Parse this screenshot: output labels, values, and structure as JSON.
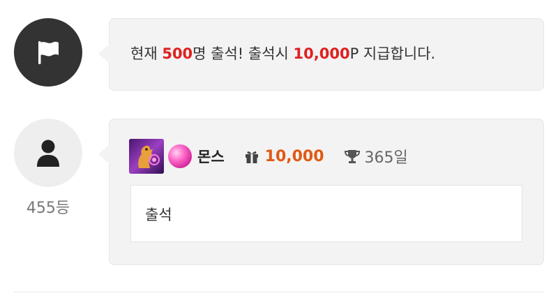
{
  "notice": {
    "prefix": "현재 ",
    "count": "500",
    "middle": "명 출석! 출석시 ",
    "reward": "10,000",
    "suffix": "P 지급합니다."
  },
  "post": {
    "rank": "455등",
    "nickname": "몬스",
    "points": "10,000",
    "days": "365일",
    "content": "출석"
  },
  "icons": {
    "notice_avatar": "flag-icon",
    "user_avatar": "user-icon",
    "level_badge": "level-badge-icon",
    "gem": "gem-icon",
    "gift": "gift-icon",
    "trophy": "trophy-icon"
  },
  "colors": {
    "highlight": "#e02020",
    "points": "#e05a14",
    "bubble_bg": "#f3f3f3",
    "dark_avatar": "#333333"
  }
}
